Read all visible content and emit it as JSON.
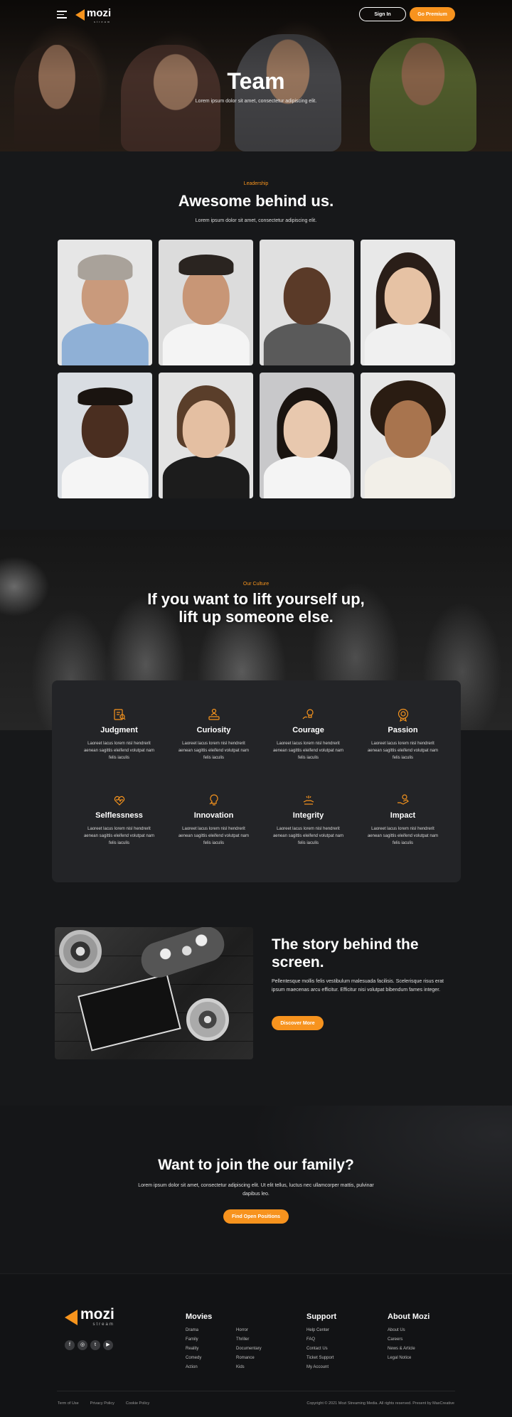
{
  "header": {
    "logo_text": "mozi",
    "logo_sub": "stream",
    "signin_label": "Sign In",
    "premium_label": "Go Premium"
  },
  "hero": {
    "title": "Team",
    "subtitle": "Lorem ipsum dolor sit amet, consectetur adipiscing elit."
  },
  "leadership": {
    "eyebrow": "Leadership",
    "title": "Awesome behind us.",
    "subtitle": "Lorem ipsum dolor sit amet, consectetur adipiscing elit."
  },
  "culture": {
    "eyebrow": "Our Culture",
    "title_line1": "If you want to lift yourself up,",
    "title_line2": "lift up someone else.",
    "values": [
      {
        "name": "Judgment",
        "icon": "judgment-icon",
        "text": "Laoreet lacus lorem nisl hendrerit aenean sagittis eleifend volutpat nam felis iaculis"
      },
      {
        "name": "Curiosity",
        "icon": "curiosity-icon",
        "text": "Laoreet lacus lorem nisl hendrerit aenean sagittis eleifend volutpat nam felis iaculis"
      },
      {
        "name": "Courage",
        "icon": "courage-icon",
        "text": "Laoreet lacus lorem nisl hendrerit aenean sagittis eleifend volutpat nam felis iaculis"
      },
      {
        "name": "Passion",
        "icon": "passion-icon",
        "text": "Laoreet lacus lorem nisl hendrerit aenean sagittis eleifend volutpat nam felis iaculis"
      },
      {
        "name": "Selflessness",
        "icon": "selflessness-icon",
        "text": "Laoreet lacus lorem nisl hendrerit aenean sagittis eleifend volutpat nam felis iaculis"
      },
      {
        "name": "Innovation",
        "icon": "innovation-icon",
        "text": "Laoreet lacus lorem nisl hendrerit aenean sagittis eleifend volutpat nam felis iaculis"
      },
      {
        "name": "Integrity",
        "icon": "integrity-icon",
        "text": "Laoreet lacus lorem nisl hendrerit aenean sagittis eleifend volutpat nam felis iaculis"
      },
      {
        "name": "Impact",
        "icon": "impact-icon",
        "text": "Laoreet lacus lorem nisl hendrerit aenean sagittis eleifend volutpat nam felis iaculis"
      }
    ]
  },
  "story": {
    "title": "The story behind the screen.",
    "text": "Pellentesque mollis felis vestibulum malesuada facilisis. Scelerisque risus erat ipsum maecenas arcu efficitur. Efficitur nisi volutpat bibendum fames integer.",
    "button_label": "Discover More"
  },
  "join": {
    "title": "Want to join the our family?",
    "text": "Lorem ipsum dolor sit amet, consectetur adipiscing elit. Ut elit tellus, luctus nec ullamcorper mattis, pulvinar dapibus leo.",
    "button_label": "Find Open Positions"
  },
  "footer": {
    "logo_text": "mozi",
    "logo_sub": "stream",
    "socials": [
      "facebook-icon",
      "instagram-icon",
      "twitter-icon",
      "youtube-icon"
    ],
    "movies": {
      "title": "Movies",
      "col1": [
        "Drama",
        "Family",
        "Reality",
        "Comedy",
        "Action"
      ],
      "col2": [
        "Horror",
        "Thriller",
        "Documentary",
        "Romance",
        "Kids"
      ]
    },
    "support": {
      "title": "Support",
      "links": [
        "Help Center",
        "FAQ",
        "Contact Us",
        "Ticket Support",
        "My Account"
      ]
    },
    "about": {
      "title": "About Mozi",
      "links": [
        "About Us",
        "Careers",
        "News & Article",
        "Legal Notice"
      ]
    },
    "bottom_links": [
      "Term of Use",
      "Privacy Policy",
      "Cookie Policy"
    ],
    "copyright": "Copyright © 2021 Mozi Streaming Media. All rights reserved. Present by MaxCreative"
  },
  "colors": {
    "accent": "#f7931e",
    "background": "#17181a",
    "panel": "#232427"
  }
}
